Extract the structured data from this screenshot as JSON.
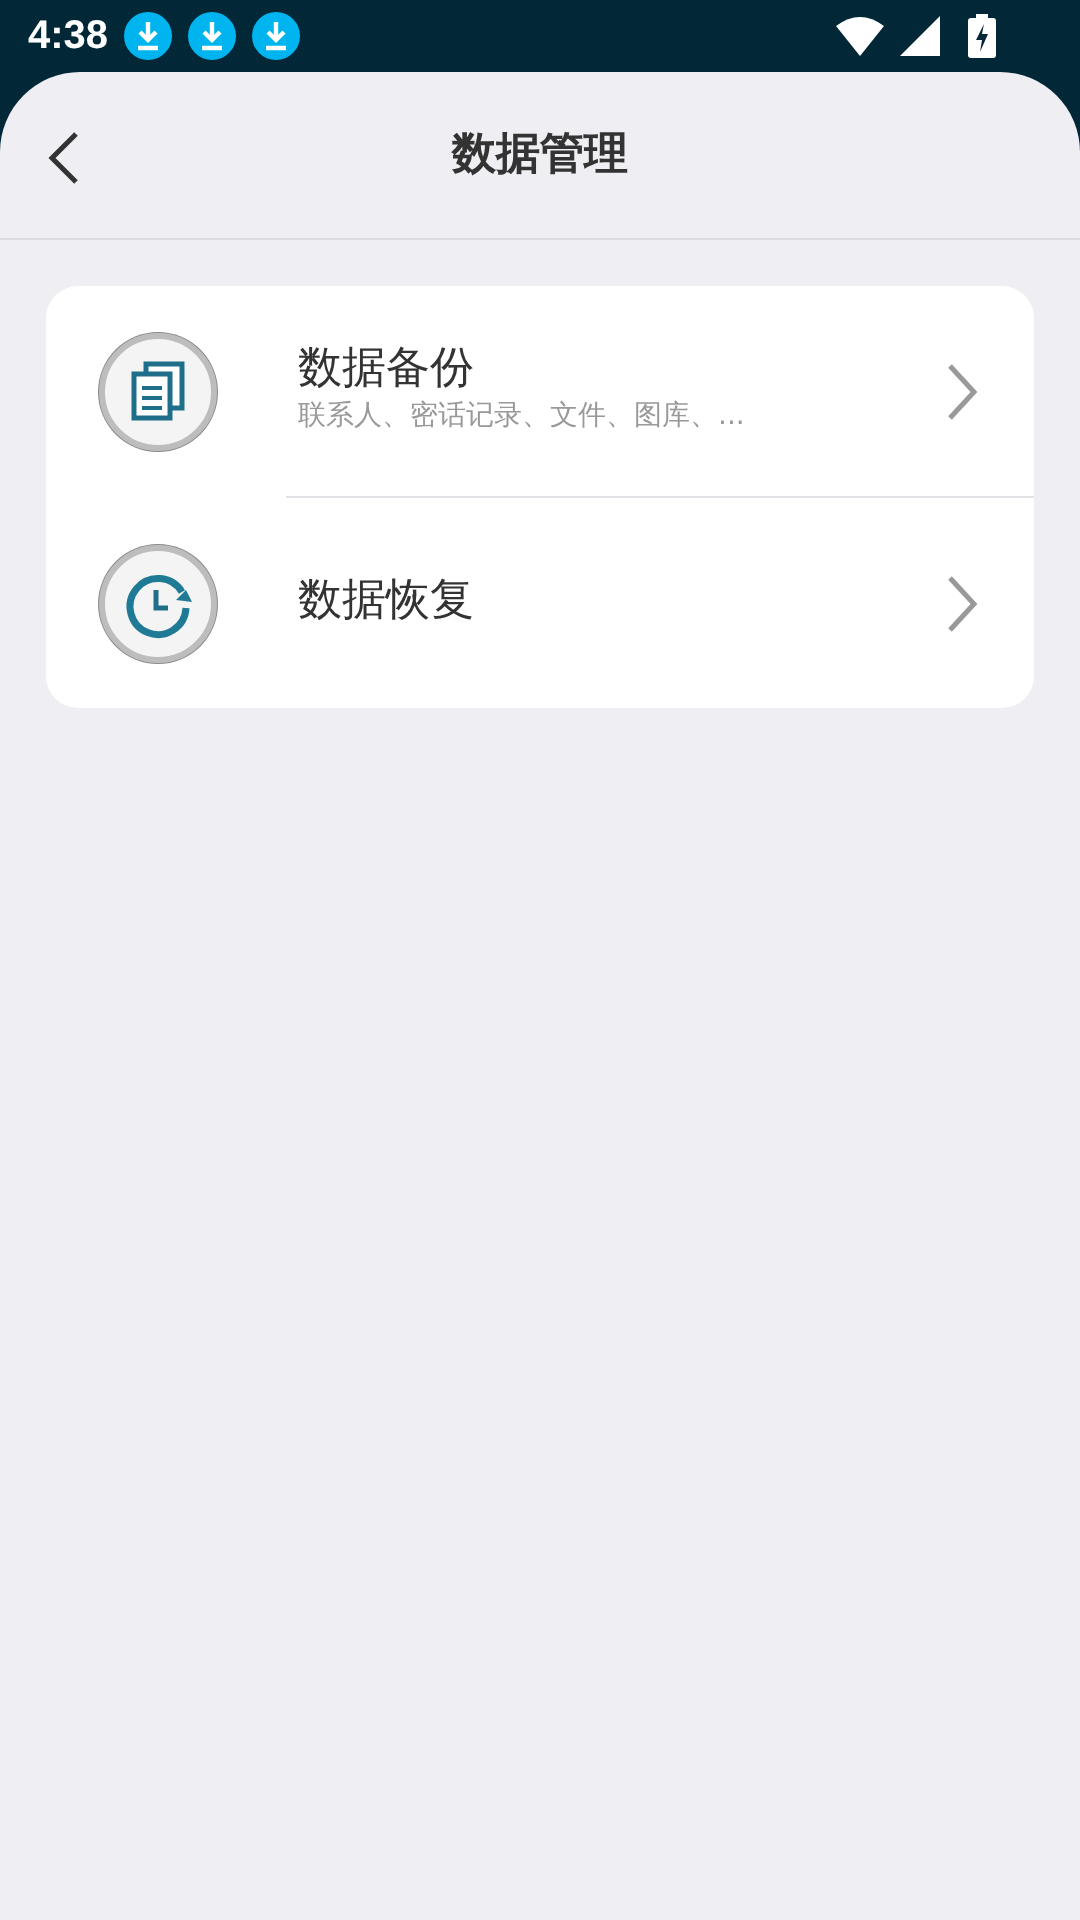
{
  "status_bar": {
    "time": "4:38",
    "notifications": [
      {
        "kind": "download"
      },
      {
        "kind": "download"
      },
      {
        "kind": "download"
      }
    ]
  },
  "header": {
    "title": "数据管理"
  },
  "items": [
    {
      "kind": "documents",
      "title": "数据备份",
      "subtitle": "联系人、密话记录、文件、图库、..."
    },
    {
      "kind": "clock",
      "title": "数据恢复"
    }
  ]
}
